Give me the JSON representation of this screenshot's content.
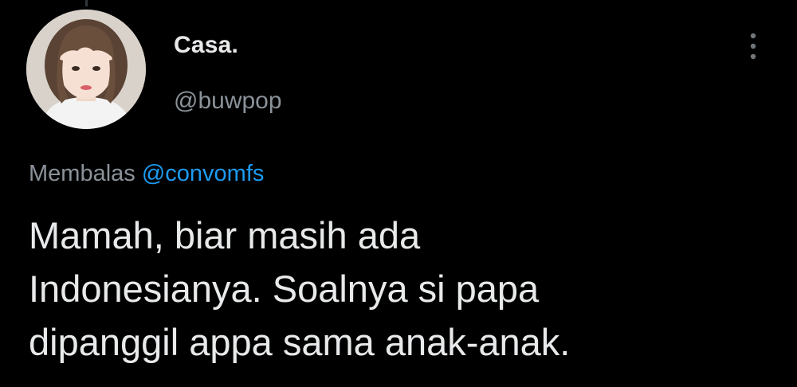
{
  "author": {
    "display_name": "Casa.",
    "handle": "@buwpop",
    "avatar_icon": "profile-photo"
  },
  "reply": {
    "prefix": "Membalas",
    "mention": "@convomfs"
  },
  "tweet": {
    "text": "Mamah, biar masih ada\nIndonesianya. Soalnya si papa\ndipanggil appa sama anak-anak."
  },
  "menu": {
    "icon": "more-vertical-icon"
  },
  "colors": {
    "background": "#000000",
    "primary_text": "#e7e9ea",
    "secondary_text": "#8b9299",
    "accent": "#1d9bf0"
  }
}
